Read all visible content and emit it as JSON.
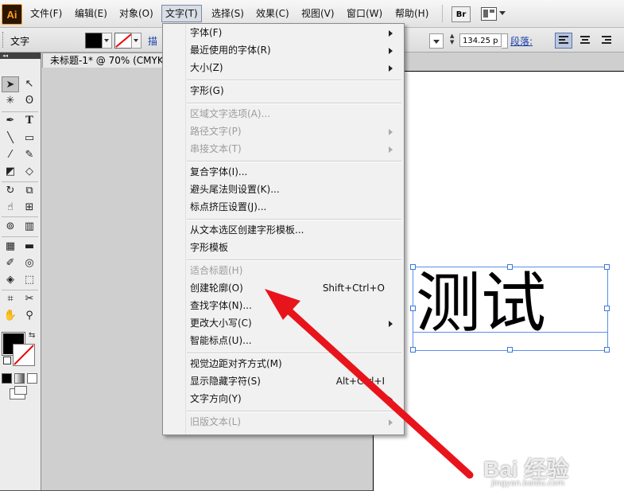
{
  "app": {
    "logo": "Ai"
  },
  "menubar": {
    "items": [
      "文件(F)",
      "编辑(E)",
      "对象(O)",
      "文字(T)",
      "选择(S)",
      "效果(C)",
      "视图(V)",
      "窗口(W)",
      "帮助(H)"
    ],
    "active_item": "文字(T)",
    "bridge_label": "Br"
  },
  "controlbar": {
    "tool_label": "文字",
    "link_text": "描",
    "leading_value": "134.25 p",
    "paragraph_label": "段落:"
  },
  "document": {
    "tab_title": "未标题-1* @ 70% (CMYK",
    "sample_text": "测试"
  },
  "type_menu": {
    "items": [
      {
        "label": "字体(F)",
        "submenu": true,
        "enabled": true
      },
      {
        "label": "最近使用的字体(R)",
        "submenu": true,
        "enabled": true
      },
      {
        "label": "大小(Z)",
        "submenu": true,
        "enabled": true
      },
      {
        "label": "字形(G)",
        "enabled": true
      },
      {
        "label": "区域文字选项(A)...",
        "enabled": false
      },
      {
        "label": "路径文字(P)",
        "submenu": true,
        "enabled": false
      },
      {
        "label": "串接文本(T)",
        "submenu": true,
        "enabled": false
      },
      {
        "label": "复合字体(I)...",
        "enabled": true
      },
      {
        "label": "避头尾法则设置(K)...",
        "enabled": true
      },
      {
        "label": "标点挤压设置(J)...",
        "enabled": true
      },
      {
        "label": "从文本选区创建字形模板...",
        "enabled": true
      },
      {
        "label": "字形模板",
        "enabled": true
      },
      {
        "label": "适合标题(H)",
        "enabled": false
      },
      {
        "label": "创建轮廓(O)",
        "shortcut": "Shift+Ctrl+O",
        "enabled": true
      },
      {
        "label": "查找字体(N)...",
        "enabled": true
      },
      {
        "label": "更改大小写(C)",
        "submenu": true,
        "enabled": true
      },
      {
        "label": "智能标点(U)...",
        "enabled": true
      },
      {
        "label": "视觉边距对齐方式(M)",
        "enabled": true
      },
      {
        "label": "显示隐藏字符(S)",
        "shortcut": "Alt+Ctrl+I",
        "enabled": true
      },
      {
        "label": "文字方向(Y)",
        "submenu": true,
        "enabled": true
      },
      {
        "label": "旧版文本(L)",
        "submenu": true,
        "enabled": false
      }
    ]
  },
  "watermark": {
    "text": "Bai 经验",
    "url": "jingyan.baidu.com"
  },
  "colors": {
    "arrow": "#e8141b",
    "selection": "#3c78dc",
    "logo_bg": "#2a1600",
    "logo_fg": "#ff9e16"
  }
}
